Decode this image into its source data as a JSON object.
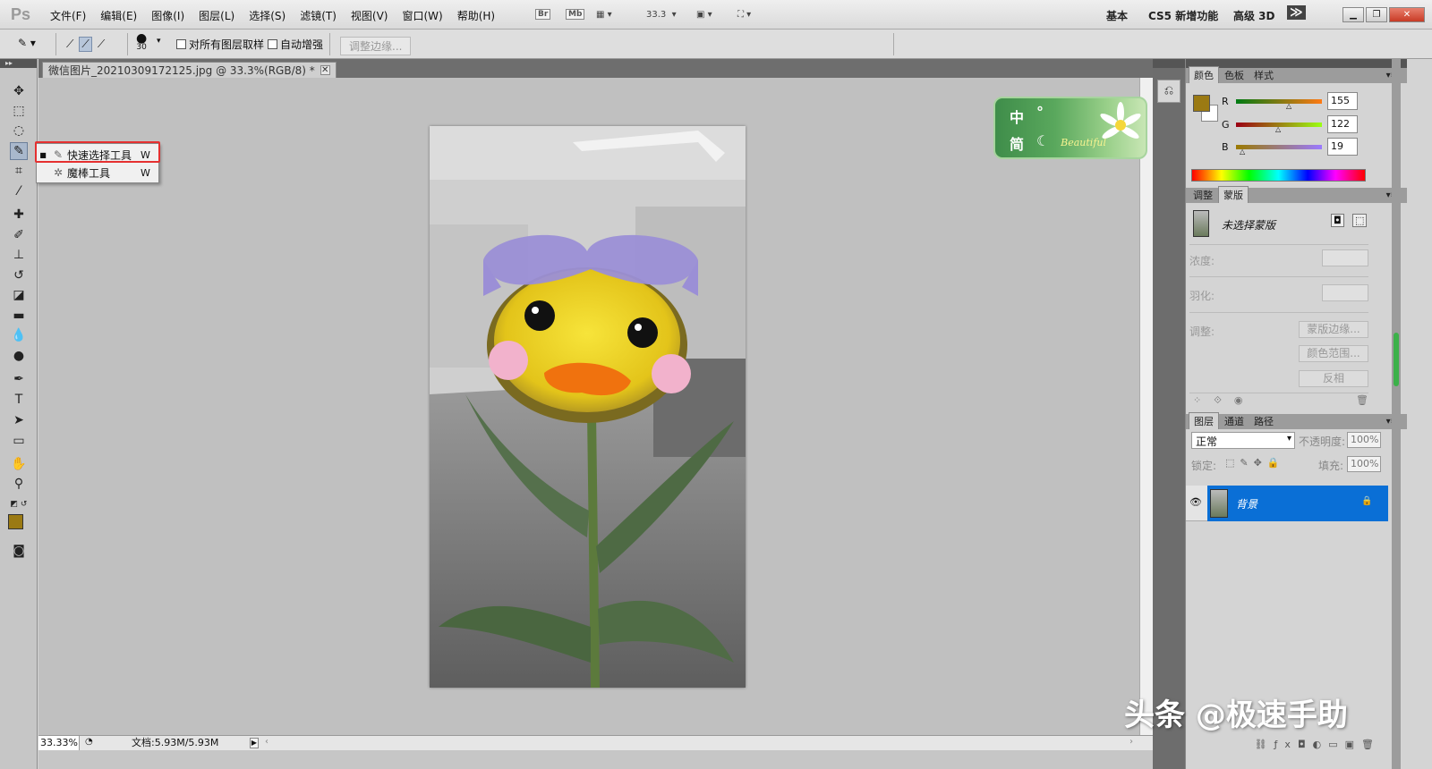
{
  "app": {
    "logo": "Ps",
    "menus": [
      "文件(F)",
      "编辑(E)",
      "图像(I)",
      "图层(L)",
      "选择(S)",
      "滤镜(T)",
      "视图(V)",
      "窗口(W)",
      "帮助(H)"
    ],
    "bridge_btn": "Br",
    "minibridge_btn": "Mb",
    "zoom_level": "33.3",
    "workspaces": [
      "基本",
      "CS5 新增功能",
      "高级 3D"
    ],
    "expand_icon": "≫"
  },
  "options_bar": {
    "brush_size": "30",
    "sample_all_layers": "对所有图层取样",
    "auto_enhance": "自动增强",
    "refine_edge": "调整边缘..."
  },
  "flyout": {
    "items": [
      {
        "label": "快速选择工具",
        "key": "W",
        "bullet": "■",
        "icon": "quick-select-icon"
      },
      {
        "label": "魔棒工具",
        "key": "W",
        "bullet": "",
        "icon": "magic-wand-icon"
      }
    ]
  },
  "document": {
    "tab_title": "微信图片_20210309172125.jpg @ 33.3%(RGB/8) *",
    "zoom": "33.33%",
    "doc_size": "文档:5.93M/5.93M"
  },
  "ime": {
    "char1": "中",
    "char2": "简",
    "punct": "°",
    "moon": "☾",
    "beautiful": "Beautiful"
  },
  "color_panel": {
    "tabs": [
      "颜色",
      "色板",
      "样式"
    ],
    "r_label": "R",
    "g_label": "G",
    "b_label": "B",
    "r": "155",
    "g": "122",
    "b": "19",
    "fg_color": "#9b7a13"
  },
  "masks_panel": {
    "tabs": [
      "调整",
      "蒙版"
    ],
    "no_mask": "未选择蒙版",
    "density": "浓度:",
    "feather": "羽化:",
    "refine": "调整:",
    "mask_edge": "蒙版边缘...",
    "color_range": "颜色范围...",
    "invert": "反相"
  },
  "layers_panel": {
    "tabs": [
      "图层",
      "通道",
      "路径"
    ],
    "blend_mode": "正常",
    "opacity_label": "不透明度:",
    "opacity": "100%",
    "lock_label": "锁定:",
    "fill_label": "填充:",
    "fill": "100%",
    "layer_name": "背景"
  },
  "watermark": "头条 @极速手助"
}
